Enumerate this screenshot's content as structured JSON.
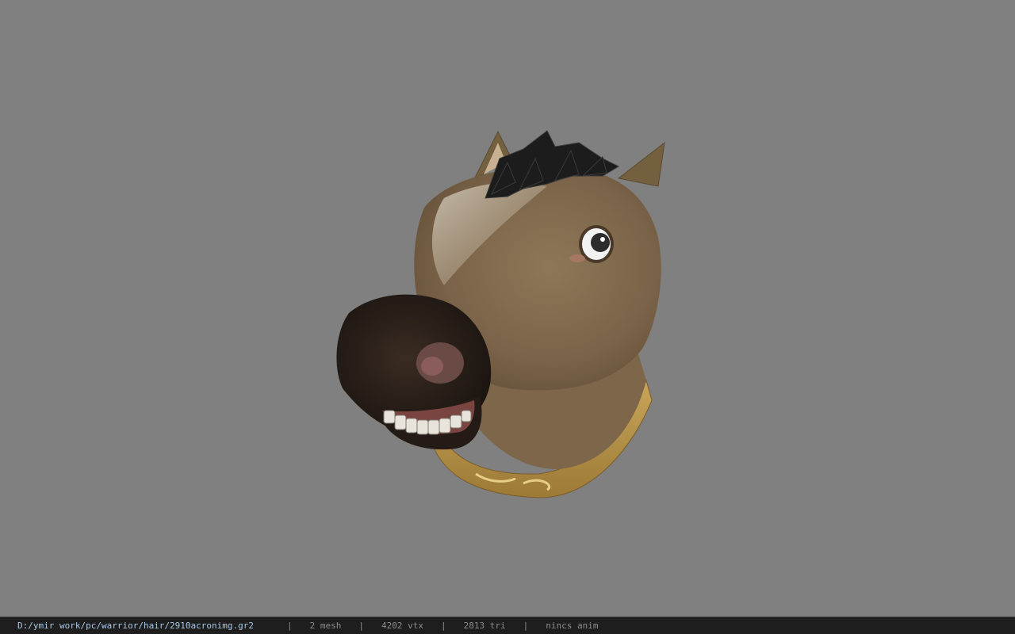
{
  "viewport": {
    "background": "#808080",
    "model_name": "horse-head-mask"
  },
  "status": {
    "file_path": "D:/ymir work/pc/warrior/hair/2910acronimg.gr2",
    "separator": "|",
    "mesh": "2 mesh",
    "vertices": "4202 vtx",
    "triangles": "2813 tri",
    "anim": "nincs anim"
  },
  "colors": {
    "statusbar_bg": "#1e1e1e",
    "path_text": "#a8c8e8",
    "stat_text": "#8c8c8c"
  }
}
